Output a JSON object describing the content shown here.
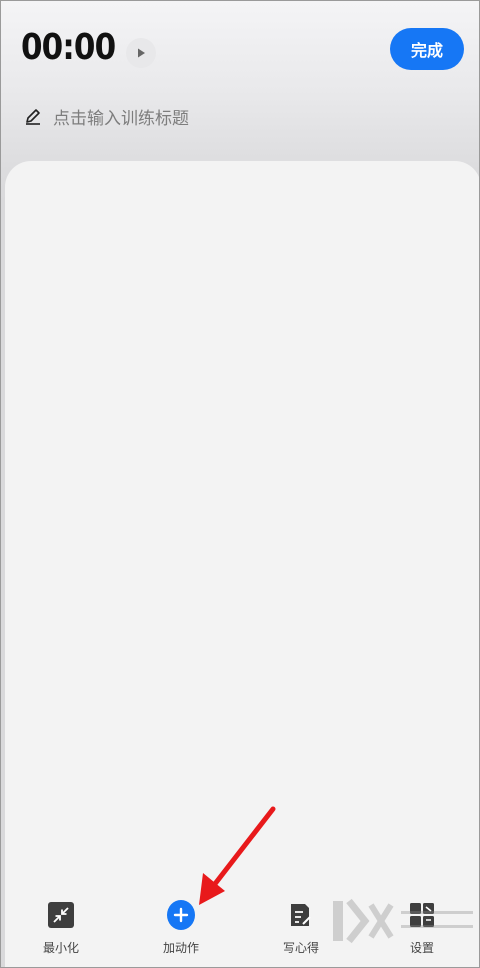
{
  "header": {
    "timer": "00:00",
    "done_label": "完成",
    "title_placeholder": "点击输入训练标题"
  },
  "bottom_bar": {
    "items": [
      {
        "label": "最小化",
        "icon": "minimize-icon"
      },
      {
        "label": "加动作",
        "icon": "add-icon"
      },
      {
        "label": "写心得",
        "icon": "note-edit-icon"
      },
      {
        "label": "设置",
        "icon": "settings-icon"
      }
    ]
  },
  "colors": {
    "accent": "#1677f5",
    "annotation_arrow": "#e8191b"
  }
}
